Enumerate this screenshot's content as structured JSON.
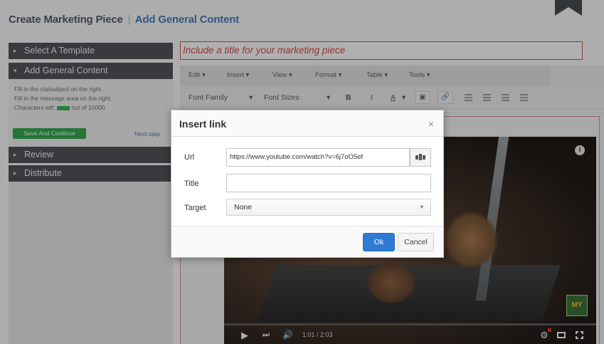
{
  "header": {
    "title": "Create Marketing Piece",
    "separator": "|",
    "subtitle": "Add General Content"
  },
  "sidebar": {
    "sections": [
      {
        "label": "Select A Template",
        "arrow": "▸"
      },
      {
        "label": "Add General Content",
        "arrow": "▾"
      },
      {
        "label": "Review",
        "arrow": "▸"
      },
      {
        "label": "Distribute",
        "arrow": "▸"
      }
    ],
    "help_lines": [
      "Fill in the cta/subject on the right.",
      "Fill in the message area on the right."
    ],
    "chars_left_prefix": "Characters left:",
    "chars_left_suffix": "out of 10000",
    "save_button": "Save And Continue",
    "next_step": "Next step"
  },
  "editor": {
    "title_placeholder": "Include a title for your marketing piece",
    "menu": [
      "Edit ▾",
      "Insert ▾",
      "View ▾",
      "Format ▾",
      "Table ▾",
      "Tools ▾"
    ],
    "font_family": "Font Family",
    "font_size": "Font Sizes",
    "dropdown_caret": "▾",
    "bold": "B",
    "italic": "I",
    "underline_color": "A",
    "image_btn": "▣",
    "link_btn": "🔗"
  },
  "video": {
    "info": "i",
    "logo": "MY",
    "play": "▶",
    "next": "⏭",
    "volume": "🔊",
    "time": "1:01 / 2:03",
    "settings": "⚙",
    "progress_fraction": 0
  },
  "dialog": {
    "title": "Insert link",
    "close": "×",
    "url_label": "Url",
    "url_value": "https://www.youtube.com/watch?v=6j7oO5ef",
    "title_label": "Title",
    "title_value": "",
    "target_label": "Target",
    "target_value": "None",
    "target_caret": "▾",
    "ok": "Ok",
    "cancel": "Cancel"
  },
  "colors": {
    "accent_blue": "#3a78ba",
    "ok_blue": "#2e7bd6",
    "save_green": "#28a745",
    "error_red": "#cf4545",
    "sidebar_dark": "#474a4f"
  }
}
